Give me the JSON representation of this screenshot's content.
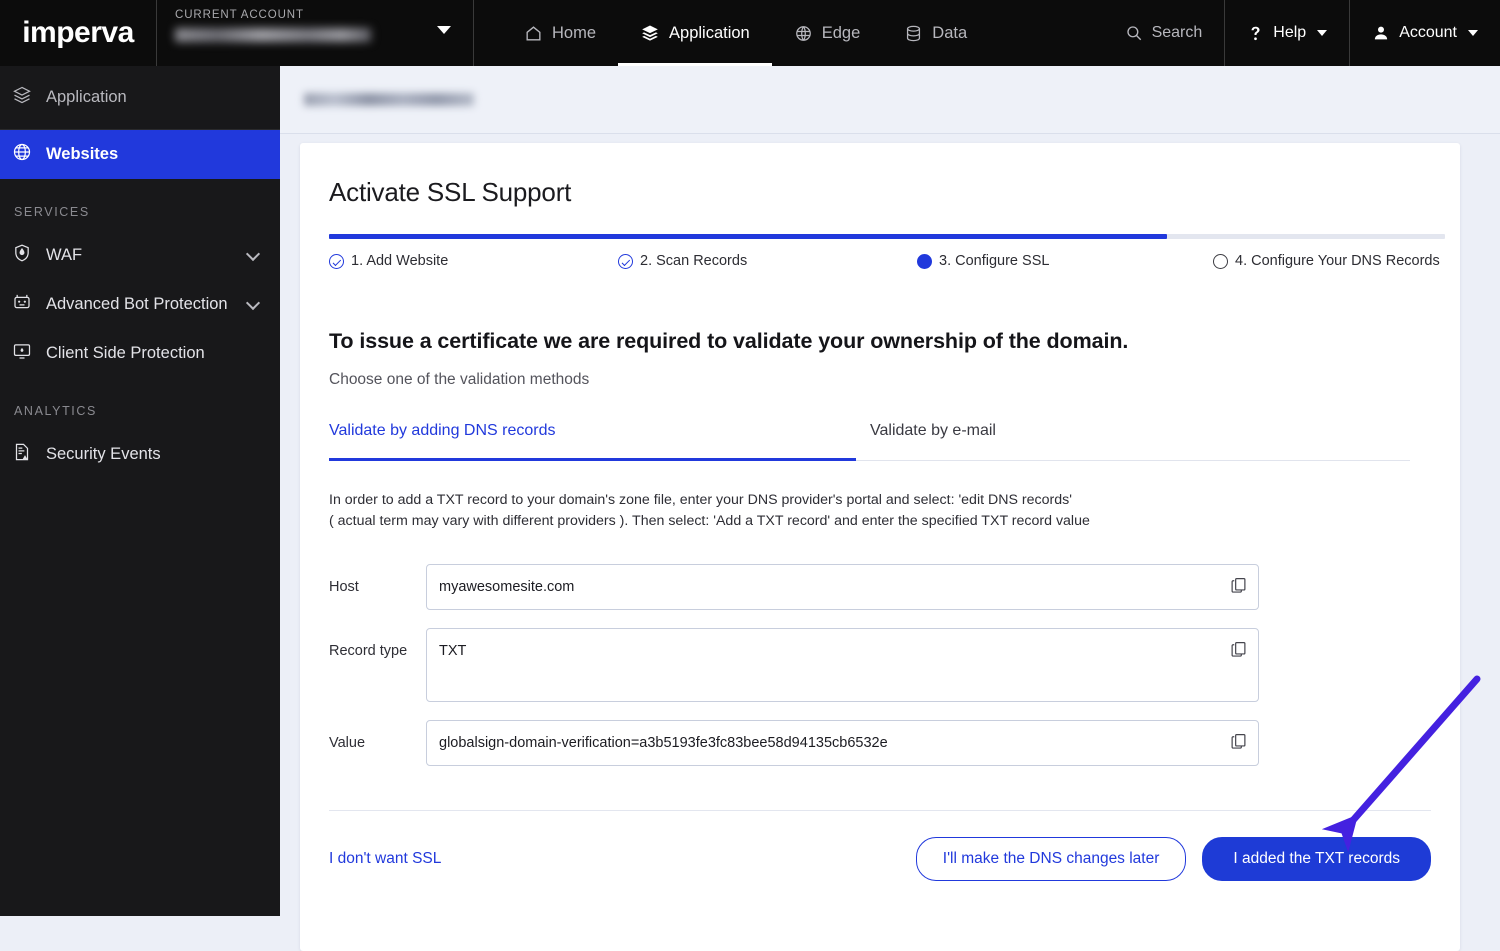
{
  "topbar": {
    "logo": "imperva",
    "account_label": "CURRENT ACCOUNT",
    "account_value": "",
    "nav": [
      {
        "label": "Home",
        "icon": "home-icon",
        "active": false
      },
      {
        "label": "Application",
        "icon": "layers-icon",
        "active": true
      },
      {
        "label": "Edge",
        "icon": "globe-icon",
        "active": false
      },
      {
        "label": "Data",
        "icon": "database-icon",
        "active": false
      }
    ],
    "search": "Search",
    "help": "Help",
    "account": "Account"
  },
  "sidebar": {
    "app_label": "Application",
    "items": [
      {
        "label": "Websites",
        "icon": "globe-icon",
        "active": true
      }
    ],
    "sections": [
      {
        "title": "SERVICES",
        "items": [
          {
            "label": "WAF",
            "icon": "shield-flame-icon",
            "expandable": true
          },
          {
            "label": "Advanced Bot Protection",
            "icon": "robot-icon",
            "expandable": true
          },
          {
            "label": "Client Side Protection",
            "icon": "monitor-shield-icon",
            "expandable": false
          }
        ]
      },
      {
        "title": "ANALYTICS",
        "items": [
          {
            "label": "Security Events",
            "icon": "document-alert-icon",
            "expandable": false
          }
        ]
      }
    ]
  },
  "breadcrumb": {
    "value": ""
  },
  "card": {
    "title": "Activate SSL Support",
    "progress_percent": 75,
    "steps": [
      {
        "label": "1. Add Website",
        "state": "complete"
      },
      {
        "label": "2. Scan Records",
        "state": "complete"
      },
      {
        "label": "3. Configure SSL",
        "state": "current"
      },
      {
        "label": "4. Configure Your DNS Records",
        "state": "pending"
      }
    ],
    "headline": "To issue a certificate we are required to validate your ownership of the domain.",
    "subline": "Choose one of the validation methods",
    "tabs": [
      {
        "label": "Validate by adding DNS records",
        "active": true
      },
      {
        "label": "Validate by e-mail",
        "active": false
      }
    ],
    "paragraph_line1": "In order to add a TXT record to your domain's zone file, enter your DNS provider's portal and select: 'edit DNS records'",
    "paragraph_line2": "( actual term may vary with different providers ). Then select: 'Add a TXT record' and enter the specified TXT record value",
    "fields": [
      {
        "label": "Host",
        "value": "myawesomesite.com",
        "copy_icon": "copy-icon"
      },
      {
        "label": "Record type",
        "value": "TXT",
        "copy_icon": "copy-icon"
      },
      {
        "label": "Value",
        "value": "globalsign-domain-verification=a3b5193fe3fc83bee58d94135cb6532e",
        "copy_icon": "copy-icon"
      }
    ],
    "footer": {
      "decline_link": "I don't want SSL",
      "secondary_button": "I'll make the DNS changes later",
      "primary_button": "I added the TXT records"
    }
  },
  "colors": {
    "accent_blue": "#2139dc",
    "primary_button": "#1e3bd6",
    "topbar_black": "#0c0c0c",
    "sidebar_black": "#18181a",
    "page_background": "#eceff7",
    "annotation_arrow": "#4421e0"
  },
  "annotation": {
    "arrow": "arrow-pointing-to-primary-button"
  }
}
